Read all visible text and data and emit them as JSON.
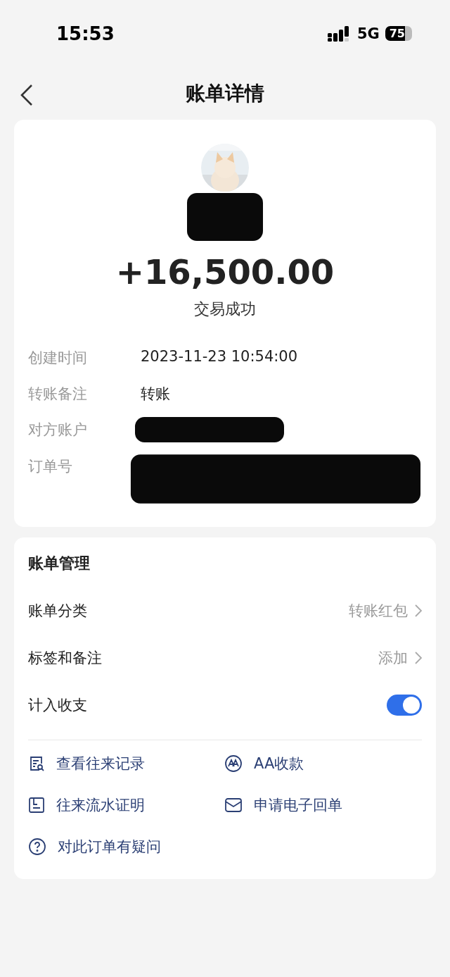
{
  "status_bar": {
    "time": "15:53",
    "network": "5G",
    "battery": "75"
  },
  "nav": {
    "title": "账单详情"
  },
  "summary": {
    "counterparty": {
      "redacted": true
    },
    "amount": "+16,500.00",
    "status": "交易成功"
  },
  "details": [
    {
      "label": "创建时间",
      "value": "2023-11-23 10:54:00"
    },
    {
      "label": "转账备注",
      "value": "转账"
    },
    {
      "label": "对方账户",
      "redacted": true
    },
    {
      "label": "订单号",
      "redacted": true
    }
  ],
  "manage": {
    "title": "账单管理",
    "rows": [
      {
        "kind": "link",
        "label": "账单分类",
        "value": "转账红包"
      },
      {
        "kind": "link",
        "label": "标签和备注",
        "value": "添加"
      },
      {
        "kind": "toggle",
        "label": "计入收支",
        "on": true
      }
    ],
    "actions": [
      {
        "label": "查看往来记录"
      },
      {
        "label": "AA收款"
      },
      {
        "label": "往来流水证明"
      },
      {
        "label": "申请电子回单"
      },
      {
        "label": "对此订单有疑问"
      }
    ]
  }
}
